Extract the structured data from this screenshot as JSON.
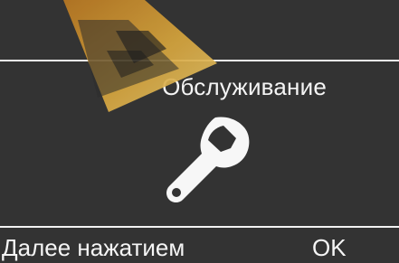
{
  "screen": {
    "title": "Обслуживание",
    "hint_left": "Далее нажатием",
    "hint_right": "OK",
    "icon": "wrench-icon"
  },
  "colors": {
    "background": "#333333",
    "text": "#f5f5f5",
    "divider": "#f2f2f2",
    "watermark": "#d8a23a"
  }
}
